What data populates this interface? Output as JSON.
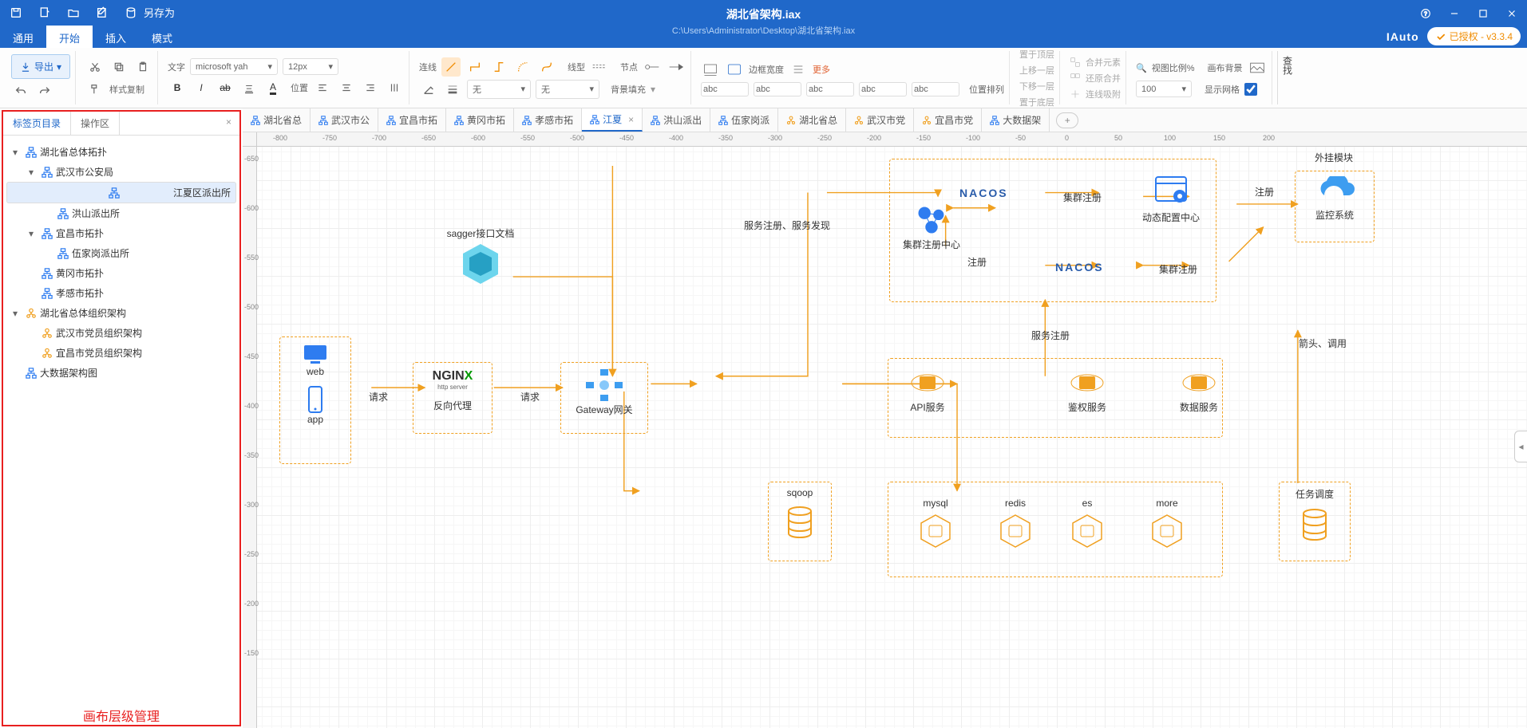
{
  "titlebar": {
    "saveas": "另存为",
    "title": "湖北省架构.iax",
    "path": "C:\\Users\\Administrator\\Desktop\\湖北省架构.iax",
    "brand": "IAuto",
    "license": "已授权 - v3.3.4"
  },
  "menus": [
    "通用",
    "开始",
    "插入",
    "模式"
  ],
  "ribbon": {
    "export": "导出",
    "style_copy": "样式复制",
    "font_label": "文字",
    "font_family": "microsoft yah",
    "font_size": "12px",
    "pos_label": "位置",
    "line_label": "连线",
    "linestyle_label": "线型",
    "node_label": "节点",
    "none1": "无",
    "none2": "无",
    "bgfill": "背景填充",
    "border_w": "边框宽度",
    "more": "更多",
    "top": "置于顶层",
    "up": "上移一层",
    "down": "下移一层",
    "pos_arr": "位置排列",
    "bottom": "置于底层",
    "merge": "合并元素",
    "restore": "还原合并",
    "snap": "连线吸附",
    "view_pct_lbl": "视图比例%",
    "view_pct": "100",
    "canvas_bg": "画布背景",
    "show_grid": "显示网格",
    "search": "查找"
  },
  "leftpane": {
    "tab1": "标签页目录",
    "tab2": "操作区",
    "note": "画布层级管理",
    "tree": [
      {
        "l": 1,
        "arrow": "▾",
        "ico": "topo",
        "txt": "湖北省总体拓扑"
      },
      {
        "l": 2,
        "arrow": "▾",
        "ico": "topo",
        "txt": "武汉市公安局"
      },
      {
        "l": 3,
        "arrow": "",
        "ico": "topo",
        "txt": "江夏区派出所",
        "sel": true
      },
      {
        "l": 3,
        "arrow": "",
        "ico": "topo",
        "txt": "洪山派出所"
      },
      {
        "l": 2,
        "arrow": "▾",
        "ico": "topo",
        "txt": "宜昌市拓扑"
      },
      {
        "l": 3,
        "arrow": "",
        "ico": "topo",
        "txt": "伍家岗派出所"
      },
      {
        "l": 2,
        "arrow": "",
        "ico": "topo",
        "txt": "黄冈市拓扑"
      },
      {
        "l": 2,
        "arrow": "",
        "ico": "topo",
        "txt": "孝感市拓扑"
      },
      {
        "l": 1,
        "arrow": "▾",
        "ico": "org",
        "txt": "湖北省总体组织架构"
      },
      {
        "l": 2,
        "arrow": "",
        "ico": "org",
        "txt": "武汉市党员组织架构"
      },
      {
        "l": 2,
        "arrow": "",
        "ico": "org",
        "txt": "宜昌市党员组织架构"
      },
      {
        "l": 1,
        "arrow": "",
        "ico": "topo",
        "txt": "大数据架构图"
      }
    ]
  },
  "doctabs": [
    {
      "ico": "topo",
      "txt": "湖北省总"
    },
    {
      "ico": "topo",
      "txt": "武汉市公"
    },
    {
      "ico": "topo",
      "txt": "宜昌市拓"
    },
    {
      "ico": "topo",
      "txt": "黄冈市拓"
    },
    {
      "ico": "topo",
      "txt": "孝感市拓"
    },
    {
      "ico": "topo",
      "txt": "江夏",
      "active": true,
      "close": true
    },
    {
      "ico": "topo",
      "txt": "洪山派出"
    },
    {
      "ico": "topo",
      "txt": "伍家岗派"
    },
    {
      "ico": "org",
      "txt": "湖北省总"
    },
    {
      "ico": "org",
      "txt": "武汉市党"
    },
    {
      "ico": "org",
      "txt": "宜昌市党"
    },
    {
      "ico": "topo",
      "txt": "大数据架"
    }
  ],
  "ruler_h": [
    -800,
    -750,
    -700,
    -650,
    -600,
    -550,
    -500,
    -450,
    -400,
    -350,
    -300,
    -250,
    -200,
    -150,
    -100,
    -50,
    0,
    50,
    100,
    150,
    200
  ],
  "ruler_v": [
    -650,
    -600,
    -550,
    -500,
    -450,
    -400,
    -350,
    -300,
    -250,
    -200,
    -150
  ],
  "diagram": {
    "ext_module": "外挂模块",
    "sagger": "sagger接口文档",
    "svc_reg_disc": "服务注册、服务发现",
    "nacos": "NACOS",
    "cluster_reg": "集群注册",
    "reg_center": "集群注册中心",
    "dyn_cfg": "动态配置中心",
    "register": "注册",
    "monitor": "监控系统",
    "svc_reg": "服务注册",
    "arrow_call": "箭头、调用",
    "web": "web",
    "app": "app",
    "request": "请求",
    "nginx": "NGINX",
    "nginx_sub": "http server",
    "rev_proxy": "反向代理",
    "gateway": "Gateway网关",
    "api_svc": "API服务",
    "auth_svc": "鉴权服务",
    "data_svc": "数据服务",
    "sqoop": "sqoop",
    "mysql": "mysql",
    "redis": "redis",
    "es": "es",
    "more_db": "more",
    "task_sched": "任务调度"
  }
}
